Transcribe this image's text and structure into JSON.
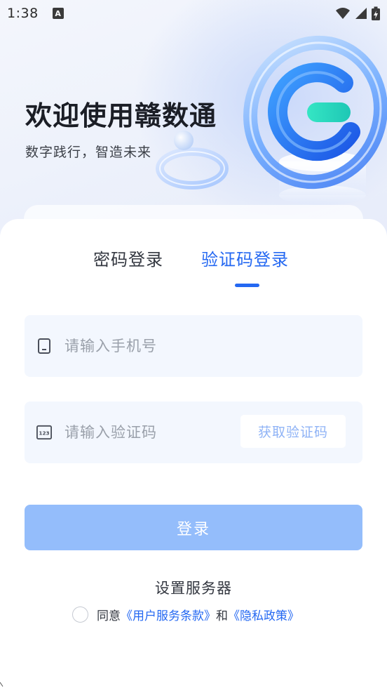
{
  "status_bar": {
    "time": "1:38",
    "notification_icon_letter": "A",
    "icons": [
      "wifi-icon",
      "signal-icon",
      "battery-charging-icon"
    ]
  },
  "hero": {
    "title": "欢迎使用赣数通",
    "subtitle": "数字践行，智造未来",
    "logo_icon": "app-logo-3d-icon"
  },
  "tabs": [
    {
      "label": "密码登录",
      "active": false
    },
    {
      "label": "验证码登录",
      "active": true
    }
  ],
  "form": {
    "phone": {
      "icon": "phone-icon",
      "value": "",
      "placeholder": "请输入手机号"
    },
    "code": {
      "icon": "number-pad-icon",
      "value": "",
      "placeholder": "请输入验证码"
    },
    "get_code_label": "获取验证码",
    "login_label": "登录"
  },
  "server_settings_label": "设置服务器",
  "agreement": {
    "checked": false,
    "prefix": "同意",
    "terms_link": "《用户服务条款》",
    "conjunction": "和",
    "privacy_link": "《隐私政策》"
  },
  "colors": {
    "accent": "#2468f2",
    "login_button_disabled": "#94bdfb",
    "field_background": "#f3f7fe"
  }
}
